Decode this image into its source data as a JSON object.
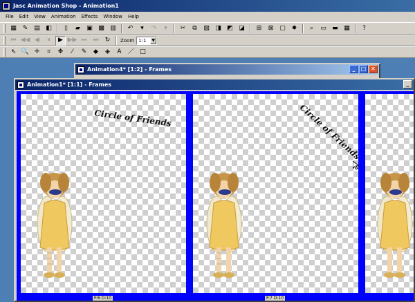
{
  "app": {
    "title": "Jasc Animation Shop - Animation1"
  },
  "menu": [
    "File",
    "Edit",
    "View",
    "Animation",
    "Effects",
    "Window",
    "Help"
  ],
  "toolbar": {
    "zoom_label": "Zoom",
    "zoom_value": "1:1"
  },
  "windows": {
    "back": {
      "title": "Animation4* [1:2] - Frames"
    },
    "front": {
      "title": "Animation1* [1:1] - Frames"
    }
  },
  "frames": [
    {
      "caption": "Circle of Friends",
      "label": "F:6  D:10"
    },
    {
      "caption": "Circle of Friends",
      "label": "F:7  D:10"
    },
    {
      "caption": "",
      "label": ""
    }
  ],
  "colors": {
    "frame_border": "#0000ff",
    "desktop": "#4d7fb4"
  }
}
